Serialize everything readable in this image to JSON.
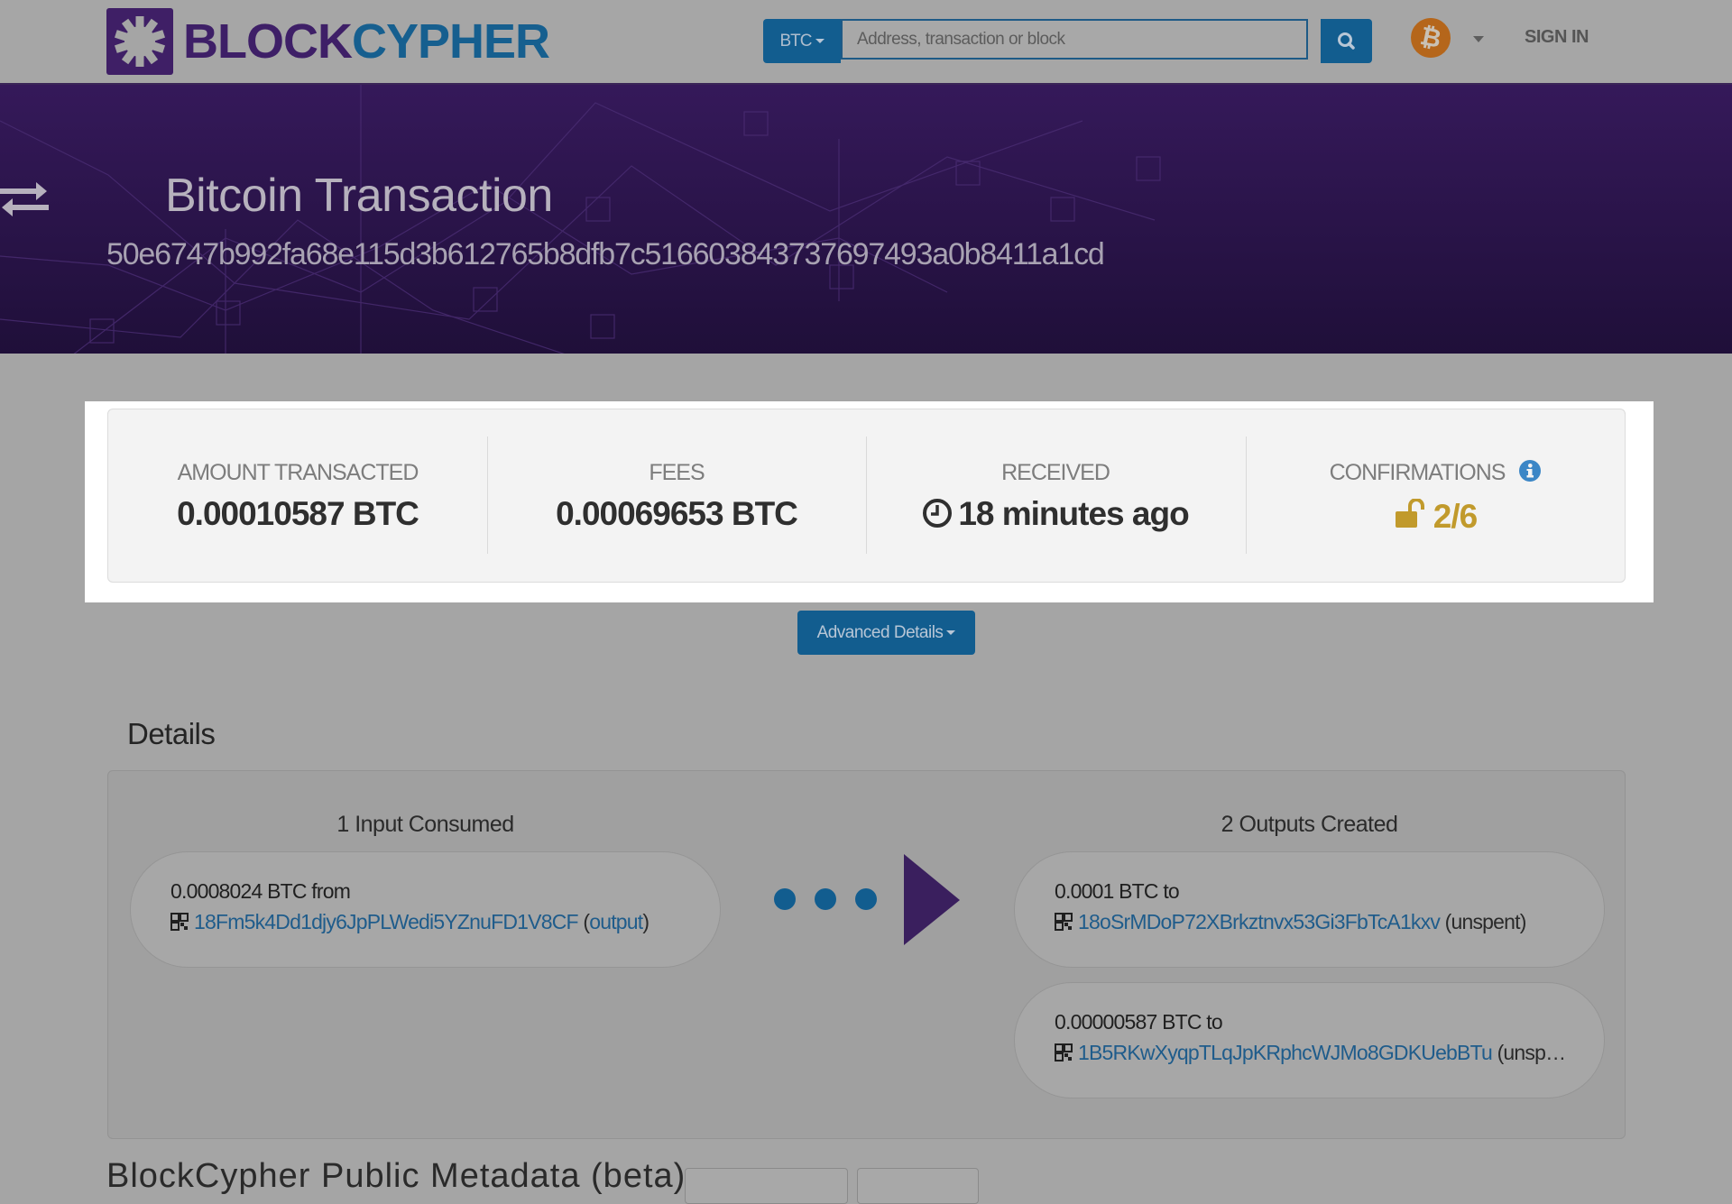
{
  "header": {
    "brand_part1": "BLOCK",
    "brand_part2": "CYPHER",
    "coin_selector": "BTC",
    "search_placeholder": "Address, transaction or block",
    "search_value": "",
    "coin_badge": "₿",
    "sign_in": "SIGN IN"
  },
  "hero": {
    "title": "Bitcoin Transaction",
    "hash": "50e6747b992fa68e115d3b612765b8dfb7c516603843737697493a0b8411a1cd"
  },
  "stats": [
    {
      "label": "AMOUNT TRANSACTED",
      "value": "0.00010587 BTC"
    },
    {
      "label": "FEES",
      "value": "0.00069653 BTC"
    },
    {
      "label": "RECEIVED",
      "value": "18 minutes ago"
    },
    {
      "label": "CONFIRMATIONS",
      "value": "2/6"
    }
  ],
  "colors": {
    "brand_purple": "#3e1f67",
    "brand_blue": "#165f8f",
    "button_blue": "#125d8f",
    "confirm_gold": "#c19a2c",
    "info_blue": "#3b86c6"
  },
  "advanced_details_label": "Advanced Details",
  "details": {
    "title": "Details",
    "inputs_heading": "1 Input Consumed",
    "outputs_heading": "2 Outputs Created",
    "inputs": [
      {
        "amount": "0.0008024 BTC from",
        "address": "18Fm5k4Dd1djy6JpPLWedi5YZnuFD1V8CF",
        "open": " (",
        "status": "output",
        "close": ")"
      }
    ],
    "outputs": [
      {
        "amount": "0.0001 BTC to",
        "address": "18oSrMDoP72XBrkztnvx53Gi3FbTcA1kxv",
        "status": " (unspent)"
      },
      {
        "amount": "0.00000587 BTC to",
        "address": "1B5RKwXyqpTLqJpKRphcWJMo8GDKUebBTu",
        "status": " (unsp…"
      }
    ]
  },
  "metadata": {
    "title": "BlockCypher Public Metadata (beta)"
  }
}
